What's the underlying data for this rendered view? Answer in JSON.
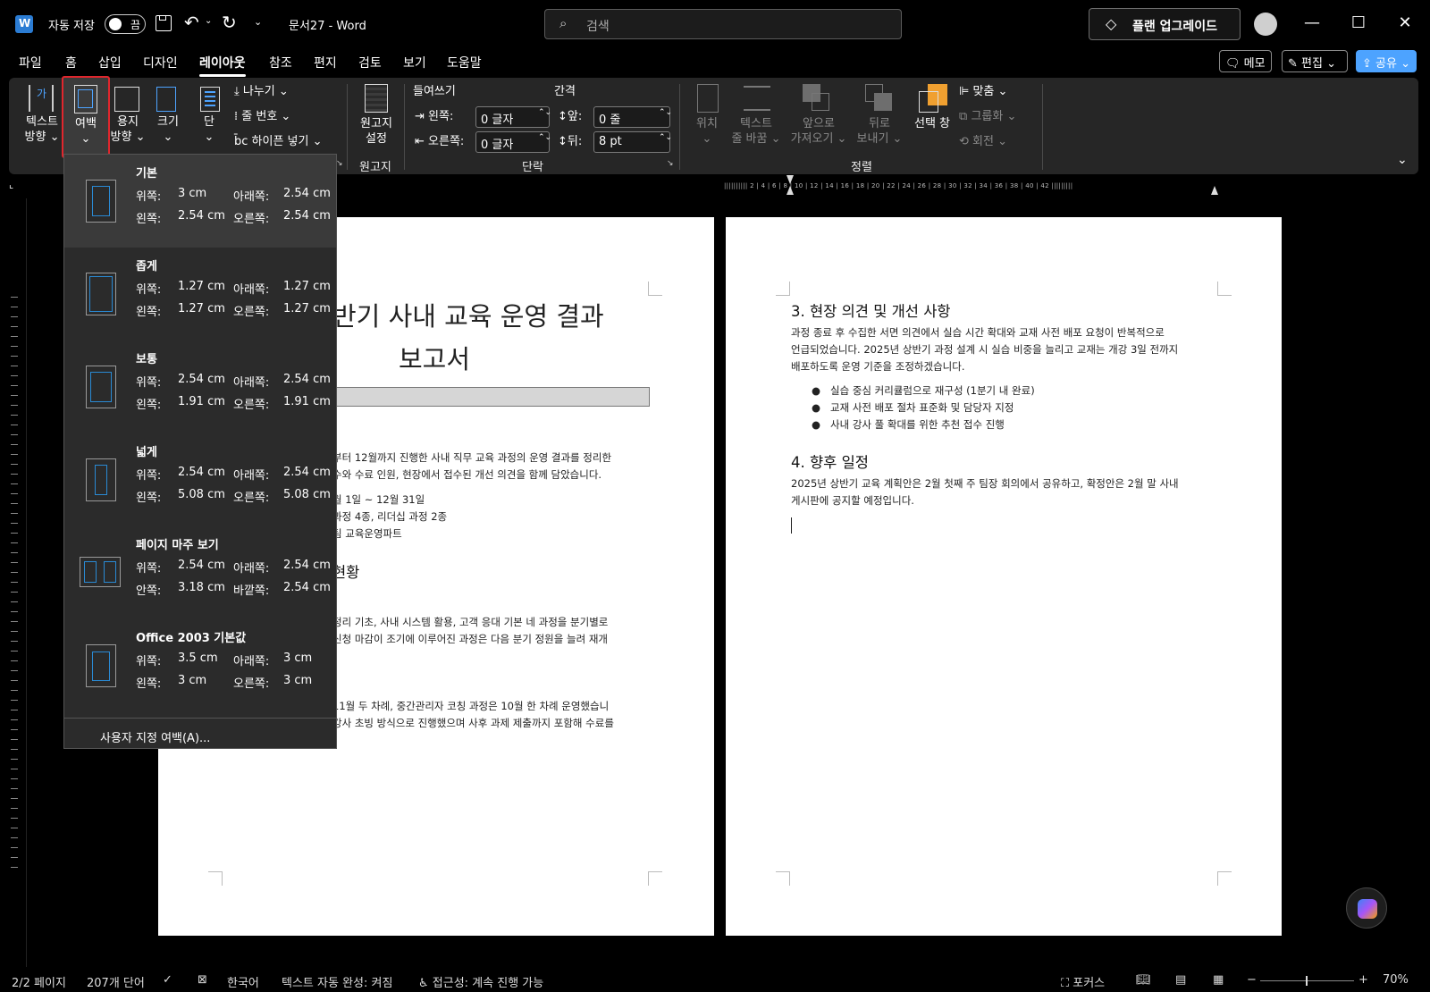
{
  "titlebar": {
    "autosave_label": "자동 저장",
    "autosave_state": "끔",
    "doc_title": "문서27  -  Word",
    "search_placeholder": "검색",
    "upgrade_label": "플랜 업그레이드"
  },
  "tabs": [
    {
      "label": "파일"
    },
    {
      "label": "홈"
    },
    {
      "label": "삽입"
    },
    {
      "label": "디자인"
    },
    {
      "label": "레이아웃"
    },
    {
      "label": "참조"
    },
    {
      "label": "편지"
    },
    {
      "label": "검토"
    },
    {
      "label": "보기"
    },
    {
      "label": "도움말"
    }
  ],
  "active_tab": "레이아웃",
  "right_actions": {
    "memo": "메모",
    "edit": "편집",
    "share": "공유"
  },
  "ribbon": {
    "page_setup": {
      "text_direction": [
        "텍스트",
        "방향"
      ],
      "margins": "여백",
      "orientation": [
        "용지",
        "방향"
      ],
      "size": "크기",
      "columns": "단",
      "breaks": "나누기",
      "line_numbers": "줄 번호",
      "hyphenation": "하이픈 넣기"
    },
    "manuscript": {
      "button": [
        "원고지",
        "설정"
      ],
      "group": "원고지"
    },
    "paragraph": {
      "indent_title": "들여쓰기",
      "spacing_title": "간격",
      "left_label": "왼쪽:",
      "left_value": "0 글자",
      "right_label": "오른쪽:",
      "right_value": "0 글자",
      "before_label": "앞:",
      "before_value": "0 줄",
      "after_label": "뒤:",
      "after_value": "8 pt",
      "group": "단락"
    },
    "arrange": {
      "position": "위치",
      "wrap": [
        "텍스트",
        "줄 바꿈"
      ],
      "forward": [
        "앞으로",
        "가져오기"
      ],
      "backward": [
        "뒤로",
        "보내기"
      ],
      "selection_pane": "선택 창",
      "align": "맞춤",
      "group_btn": "그룹화",
      "rotate": "회전",
      "group": "정렬"
    }
  },
  "ruler_label": "|||||||||| 2 | 4 | 6 | 8 | 10 | 12 | 14 | 16 | 18 | 20 | 22 | 24 | 26 | 28 | 30 | 32 | 34 | 36 | 38 | 40 | 42 |||||||||",
  "margins_menu": {
    "items": [
      {
        "name": "기본",
        "r1": [
          "위쪽:",
          "3 cm",
          "아래쪽:",
          "2.54 cm"
        ],
        "r2": [
          "왼쪽:",
          "2.54 cm",
          "오른쪽:",
          "2.54 cm"
        ]
      },
      {
        "name": "좁게",
        "r1": [
          "위쪽:",
          "1.27 cm",
          "아래쪽:",
          "1.27 cm"
        ],
        "r2": [
          "왼쪽:",
          "1.27 cm",
          "오른쪽:",
          "1.27 cm"
        ]
      },
      {
        "name": "보통",
        "r1": [
          "위쪽:",
          "2.54 cm",
          "아래쪽:",
          "2.54 cm"
        ],
        "r2": [
          "왼쪽:",
          "1.91 cm",
          "오른쪽:",
          "1.91 cm"
        ]
      },
      {
        "name": "넓게",
        "r1": [
          "위쪽:",
          "2.54 cm",
          "아래쪽:",
          "2.54 cm"
        ],
        "r2": [
          "왼쪽:",
          "5.08 cm",
          "오른쪽:",
          "5.08 cm"
        ]
      },
      {
        "name": "페이지 마주 보기",
        "r1": [
          "위쪽:",
          "2.54 cm",
          "아래쪽:",
          "2.54 cm"
        ],
        "r2": [
          "안쪽:",
          "3.18 cm",
          "바깥쪽:",
          "2.54 cm"
        ]
      },
      {
        "name": "Office 2003 기본값",
        "r1": [
          "위쪽:",
          "3.5 cm",
          "아래쪽:",
          "3 cm"
        ],
        "r2": [
          "왼쪽:",
          "3 cm",
          "오른쪽:",
          "3 cm"
        ]
      }
    ],
    "custom": "사용자 지정 여백(A)..."
  },
  "page1": {
    "title1": "반기 사내 교육 운영 결과",
    "title2": "보고서",
    "p1a": "부터 12월까지 진행한 사내 직무 교육 과정의 운영 결과를 정리한",
    "p1b": "수와 수료 인원, 현장에서 접수된 개선 의견을 함께 담았습니다.",
    "l1": "월 1일 ~ 12월 31일",
    "l2": "과정 4종, 리더십 과정 2종",
    "l3": "팀 교육운영파트",
    "h2": "현황",
    "p2a": "정리 기초, 사내 시스템 활용, 고객 응대 기본 네 과정을 분기별로",
    "p2b": "신청 마감이 조기에 이루어진 과정은 다음 분기 정원을 늘려 재개",
    "p3a": "11월 두 차례, 중간관리자 코칭 과정은 10월 한 차례 운영했습니",
    "p3b": "강사 초빙 방식으로 진행했으며 사후 과제 제출까지 포함해 수료를"
  },
  "page2": {
    "h3": "3. 현장 의견 및 개선 사항",
    "p1": "과정 종료 후 수집한 서면 의견에서 실습 시간 확대와 교재 사전 배포 요청이 반복적으로",
    "p2": "언급되었습니다. 2025년 상반기 과정 설계 시 실습 비중을 늘리고 교재는 개강 3일 전까지",
    "p3": "배포하도록 운영 기준을 조정하겠습니다.",
    "bullets": [
      "실습 중심 커리큘럼으로 재구성 (1분기 내 완료)",
      "교재 사전 배포 절차 표준화 및 담당자 지정",
      "사내 강사 풀 확대를 위한 추천 접수 진행"
    ],
    "h4": "4. 향후 일정",
    "p4": "2025년 상반기 교육 계획안은 2월 첫째 주 팀장 회의에서 공유하고, 확정안은 2월 말 사내",
    "p5": "게시판에 공지할 예정입니다."
  },
  "status": {
    "pages": "2/2 페이지",
    "words": "207개 단어",
    "language": "한국어",
    "autocomplete": "텍스트 자동 완성: 켜짐",
    "accessibility": "접근성: 계속 진행 가능",
    "focus": "포커스",
    "zoom": "70%"
  },
  "colors": {
    "accent": "#2a8ad4",
    "highlight_border": "#e0262d",
    "share_bg": "#4da3ff"
  }
}
